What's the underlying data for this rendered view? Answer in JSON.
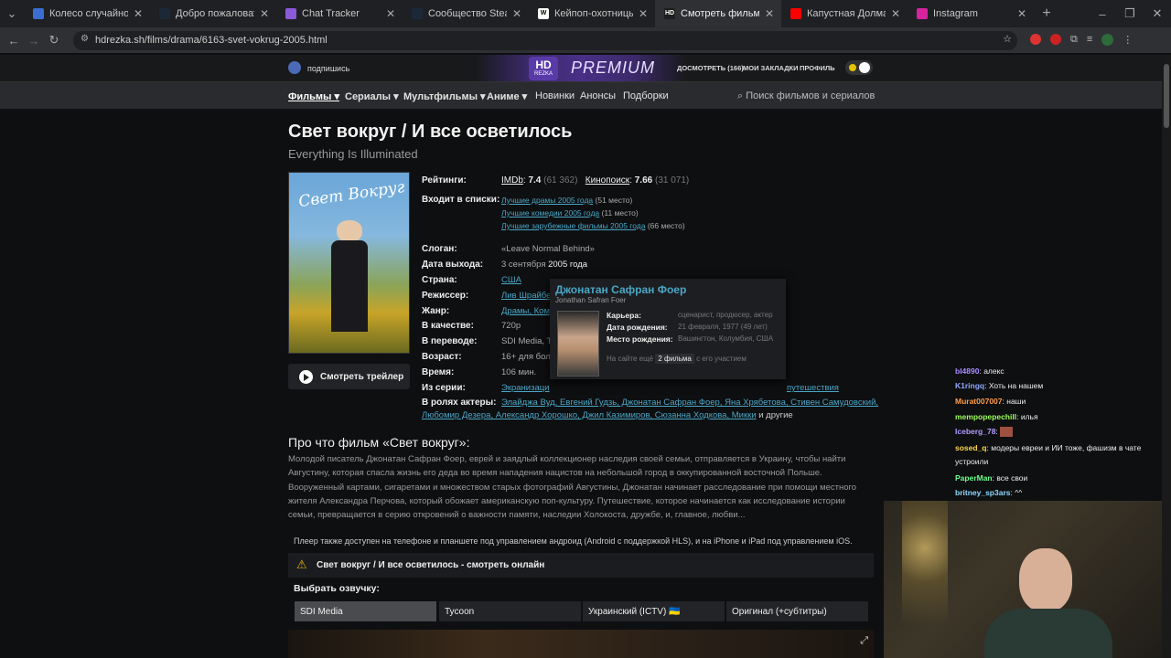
{
  "tabs": [
    {
      "title": "Колесо случайного выб",
      "color": "#3b6ed1"
    },
    {
      "title": "Добро пожаловать в Steam",
      "color": "#1b2838"
    },
    {
      "title": "Chat Tracker",
      "color": "#8a5ad8"
    },
    {
      "title": "Сообщество Steam :: люб",
      "color": "#1b2838"
    },
    {
      "title": "Кейпоп-охотницы на де",
      "color": "#ffffff",
      "letter": "W"
    },
    {
      "title": "Смотреть фильм Свет вс",
      "color": "#1e1e1e",
      "letter": "HD",
      "active": true
    },
    {
      "title": "Капустная Долма и Шор",
      "color": "#ff0000"
    },
    {
      "title": "Instagram",
      "color": "#d6249f"
    }
  ],
  "browser": {
    "url": "hdrezka.sh/films/drama/6163-svet-vokrug-2005.html"
  },
  "header": {
    "subscribe": "подпишись",
    "logo_hd": "HD",
    "logo_sub": "REZKA",
    "premium": "PREMIUM",
    "watch_later": "ДОСМОТРЕТЬ",
    "watch_count": "166",
    "bookmarks": "МОИ ЗАКЛАДКИ",
    "profile": "ПРОФИЛЬ"
  },
  "nav": {
    "films": "Фильмы",
    "series": "Сериалы",
    "cartoons": "Мультфильмы",
    "anime": "Аниме",
    "new": "Новинки",
    "announce": "Анонсы",
    "collections": "Подборки",
    "search_placeholder": "Поиск фильмов и сериалов"
  },
  "movie": {
    "title": "Свет вокруг / И все осветилось",
    "original_title": "Everything Is Illuminated",
    "poster_text": "Свет Вокруг",
    "trailer_btn": "Смотреть трейлер",
    "labels": {
      "ratings": "Рейтинги:",
      "lists": "Входит в списки:",
      "slogan": "Слоган:",
      "release": "Дата выхода:",
      "country": "Страна:",
      "director": "Режиссер:",
      "genre": "Жанр:",
      "quality": "В качестве:",
      "translation": "В переводе:",
      "age": "Возраст:",
      "time": "Время:",
      "series": "Из серии:",
      "actors": "В ролях актеры:"
    },
    "imdb_label": "IMDb",
    "imdb": "7.4",
    "imdb_votes": "(61 362)",
    "kp_label": "Кинопоиск",
    "kp": "7.66",
    "kp_votes": "(31 071)",
    "lists": [
      {
        "name": "Лучшие драмы 2005 года",
        "place": "(51 место)"
      },
      {
        "name": "Лучшие комедии 2005 года",
        "place": "(11 место)"
      },
      {
        "name": "Лучшие зарубежные фильмы 2005 года",
        "place": "(66 место)"
      }
    ],
    "slogan": "«Leave Normal Behind»",
    "release_a": "3 сентября",
    "release_b": "2005 года",
    "country": "США",
    "director": "Лив Шрайбе",
    "genre": "Драмы, Ком",
    "quality": "720p",
    "translation": "SDI Media, T",
    "age": "16+ для бол",
    "time": "106 мин.",
    "series_a": "Экранизаци",
    "series_b": "путешествия",
    "actors_line1": "Элайджа Вуд, Евгений Гудзь, Джонатан Сафран Фоер, Яна Хрябетова, Стивен Самудовский,",
    "actors_line2": "Любомир Дезера, Александр Хорошко, Джил Казимиров, Сюзанна Ходкова, Микки",
    "actors_tail": "и другие"
  },
  "popup": {
    "name": "Джонатан Сафран Фоер",
    "orig": "Jonathan Safran Foer",
    "career_l": "Карьера:",
    "career": "сценарист, продюсер, актер",
    "born_l": "Дата рождения:",
    "born": "21 февраля, 1977 (49 лет)",
    "place_l": "Место рождения:",
    "place": "Вашингтон, Колумбия, США",
    "more_a": "На сайте ещё",
    "more_b": "2 фильма",
    "more_c": "с его участием"
  },
  "about": {
    "heading": "Про что фильм «Свет вокруг»:",
    "text": "Молодой писатель Джонатан Сафран Фоер, еврей и заядлый коллекционер наследия своей семьи, отправляется в Украину, чтобы найти Августину, которая спасла жизнь его деда во время нападения нацистов на небольшой город в оккупированной восточной Польше. Вооруженный картами, сигаретами и множеством старых фотографий Августины, Джонатан начинает расследование при помощи местного жителя Александра Перчова, который обожает американскую поп-культуру. Путешествие, которое начинается как исследование истории семьи, превращается в серию откровений о важности памяти, наследии Холокоста, дружбе, и, главное, любви...",
    "player_note": "Плеер также доступен на телефоне и планшете под управлением андроид (Android с поддержкой HLS), и на iPhone и iPad под управлением iOS.",
    "watch_title": "Свет вокруг / И все осветилось - смотреть онлайн",
    "voice_heading": "Выбрать озвучку:",
    "voices": [
      "SDI Media",
      "Tycoon",
      "Украинский (ICTV) 🇺🇦",
      "Оригинал (+субтитры)"
    ]
  },
  "chat": [
    {
      "user": "bl4890",
      "text": "алекс",
      "color": "#a98cff"
    },
    {
      "user": "K1ringq",
      "text": "Хоть на нашем",
      "color": "#8fa8ff"
    },
    {
      "user": "Murat007007",
      "text": "наши",
      "color": "#ff9c4a"
    },
    {
      "user": "mempopepechill",
      "text": "илья",
      "color": "#9dff5a"
    },
    {
      "user": "Iceberg_78",
      "text": "",
      "color": "#b39cff"
    },
    {
      "user": "sosed_q",
      "text": "модеры евреи и ИИ тоже, фашизм в чате",
      "color": "#ffd84a"
    },
    {
      "user": "",
      "text": "устроили",
      "color": "#eee"
    },
    {
      "user": "PaperMan",
      "text": "все свои",
      "color": "#6aff8a"
    },
    {
      "user": "britney_sp3ars",
      "text": "^^",
      "color": "#8fd8ff"
    }
  ]
}
